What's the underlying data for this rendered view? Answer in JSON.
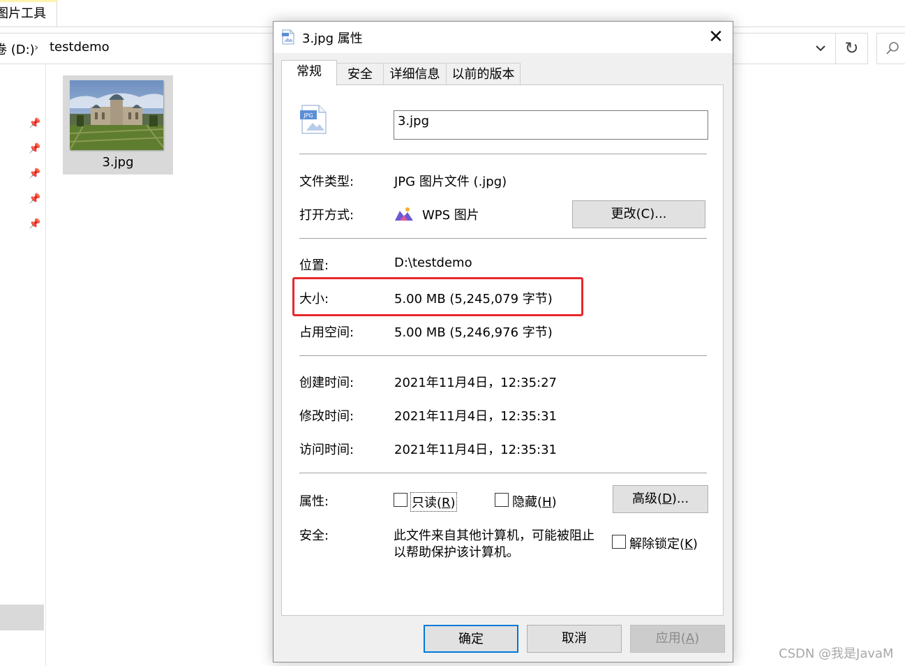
{
  "explorer": {
    "ribbon_tab": "图片工具",
    "address": {
      "drive": "卷 (D:)",
      "separator": "›",
      "folder": "testdemo"
    },
    "file": {
      "name": "3.jpg"
    }
  },
  "dialog": {
    "title": "3.jpg 属性",
    "tabs": [
      "常规",
      "安全",
      "详细信息",
      "以前的版本"
    ],
    "file_name_value": "3.jpg",
    "file_icon_badge": "JPG",
    "rows": {
      "type": {
        "label": "文件类型:",
        "value": "JPG 图片文件 (.jpg)"
      },
      "open_with": {
        "label": "打开方式:",
        "value": "WPS 图片",
        "change_button": "更改(C)..."
      },
      "location": {
        "label": "位置:",
        "value": "D:\\testdemo"
      },
      "size": {
        "label": "大小:",
        "value": "5.00 MB (5,245,079 字节)"
      },
      "size_on_disk": {
        "label": "占用空间:",
        "value": "5.00 MB (5,246,976 字节)"
      },
      "created": {
        "label": "创建时间:",
        "value": "2021年11月4日，12:35:27"
      },
      "modified": {
        "label": "修改时间:",
        "value": "2021年11月4日，12:35:31"
      },
      "accessed": {
        "label": "访问时间:",
        "value": "2021年11月4日，12:35:31"
      }
    },
    "attributes": {
      "label": "属性:",
      "readonly": {
        "text": "只读(",
        "key": "R",
        "end": ")",
        "checked": false
      },
      "hidden": {
        "text": "隐藏(",
        "key": "H",
        "end": ")",
        "checked": false
      },
      "advanced_button": {
        "text": "高级(",
        "key": "D",
        "end": ")..."
      }
    },
    "security": {
      "label": "安全:",
      "message_line1": "此文件来自其他计算机，可能被阻止",
      "message_line2": "以帮助保护该计算机。",
      "unblock": {
        "text": "解除锁定(",
        "key": "K",
        "end": ")",
        "checked": false
      }
    },
    "buttons": {
      "ok": "确定",
      "cancel": "取消",
      "apply": {
        "text": "应用(",
        "key": "A",
        "end": ")"
      }
    }
  },
  "watermark": "CSDN @我是JavaM",
  "colors": {
    "highlight": "#e8272b",
    "focus_border": "#0078d7",
    "dialog_bg": "#f0f0f0"
  }
}
